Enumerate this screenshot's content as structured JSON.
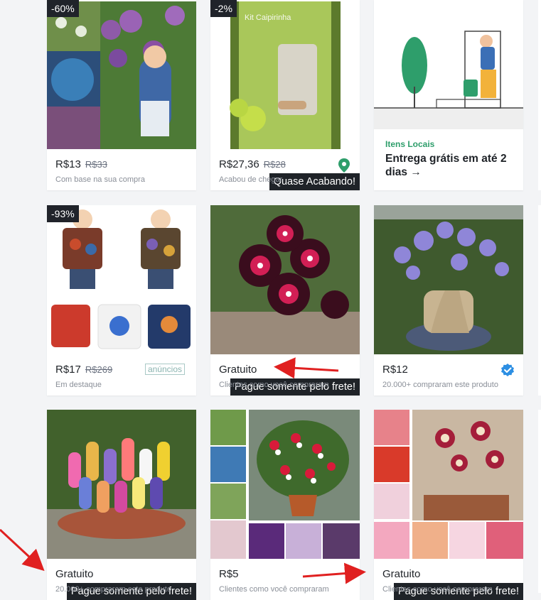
{
  "products": [
    {
      "badge": "-60%",
      "price": "R$13",
      "old_price": "R$33",
      "subtitle": "Com base na sua compra"
    },
    {
      "badge": "-2%",
      "flag": "Quase Acabando!",
      "price": "R$27,36",
      "old_price": "R$28",
      "subtitle": "Acabou de chegar",
      "image_text": "Kit Caipirinha"
    },
    {
      "kicker": "Itens Locais",
      "title": "Entrega grátis em até 2 dias",
      "arrow": "→"
    },
    {
      "badge": "-93%",
      "price": "R$17",
      "old_price": "R$269",
      "tag": "anúncios",
      "subtitle": "Em destaque"
    },
    {
      "flag": "Pague somente pelo frete!",
      "price": "Gratuito",
      "subtitle": "Clientes como você compraram"
    },
    {
      "price": "R$12",
      "subtitle": "20.000+ compraram este produto"
    },
    {
      "flag": "Pague somente pelo frete!",
      "price": "Gratuito",
      "subtitle": "20.000+ compraram este produto"
    },
    {
      "price": "R$5",
      "subtitle": "Clientes como você compraram"
    },
    {
      "flag": "Pague somente pelo frete!",
      "price": "Gratuito",
      "subtitle": "Clientes como você compraram"
    }
  ],
  "icons": {
    "pin": "location-pin-icon",
    "verified": "verified-check-icon"
  },
  "colors": {
    "accent_green": "#2e9e6b",
    "verified_blue": "#2d8fe3",
    "annotation_red": "#e02020"
  }
}
